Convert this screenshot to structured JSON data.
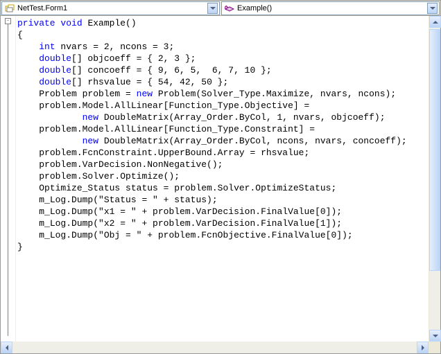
{
  "toolbar": {
    "class_selector": "NetTest.Form1",
    "member_selector": "Example()"
  },
  "code": {
    "lines": [
      {
        "indent": 0,
        "segs": [
          {
            "t": "private",
            "c": "kw"
          },
          {
            "t": " "
          },
          {
            "t": "void",
            "c": "kw"
          },
          {
            "t": " Example()"
          }
        ]
      },
      {
        "indent": 0,
        "segs": [
          {
            "t": "{"
          }
        ]
      },
      {
        "indent": 0,
        "segs": [
          {
            "t": ""
          }
        ]
      },
      {
        "indent": 1,
        "segs": [
          {
            "t": "int",
            "c": "kw"
          },
          {
            "t": " nvars = 2, ncons = 3;"
          }
        ]
      },
      {
        "indent": 1,
        "segs": [
          {
            "t": "double",
            "c": "kw"
          },
          {
            "t": "[] objcoeff = { 2, 3 };"
          }
        ]
      },
      {
        "indent": 1,
        "segs": [
          {
            "t": "double",
            "c": "kw"
          },
          {
            "t": "[] concoeff = { 9, 6, 5,  6, 7, 10 };"
          }
        ]
      },
      {
        "indent": 1,
        "segs": [
          {
            "t": "double",
            "c": "kw"
          },
          {
            "t": "[] rhsvalue = { 54, 42, 50 };"
          }
        ]
      },
      {
        "indent": 0,
        "segs": [
          {
            "t": ""
          }
        ]
      },
      {
        "indent": 1,
        "segs": [
          {
            "t": "Problem problem = "
          },
          {
            "t": "new",
            "c": "kw"
          },
          {
            "t": " Problem(Solver_Type.Maximize, nvars, ncons);"
          }
        ]
      },
      {
        "indent": 0,
        "segs": [
          {
            "t": ""
          }
        ]
      },
      {
        "indent": 1,
        "segs": [
          {
            "t": "problem.Model.AllLinear[Function_Type.Objective] ="
          }
        ]
      },
      {
        "indent": 3,
        "segs": [
          {
            "t": "new",
            "c": "kw"
          },
          {
            "t": " DoubleMatrix(Array_Order.ByCol, 1, nvars, objcoeff);"
          }
        ]
      },
      {
        "indent": 1,
        "segs": [
          {
            "t": "problem.Model.AllLinear[Function_Type.Constraint] ="
          }
        ]
      },
      {
        "indent": 3,
        "segs": [
          {
            "t": "new",
            "c": "kw"
          },
          {
            "t": " DoubleMatrix(Array_Order.ByCol, ncons, nvars, concoeff);"
          }
        ]
      },
      {
        "indent": 0,
        "segs": [
          {
            "t": ""
          }
        ]
      },
      {
        "indent": 1,
        "segs": [
          {
            "t": "problem.FcnConstraint.UpperBound.Array = rhsvalue;"
          }
        ]
      },
      {
        "indent": 0,
        "segs": [
          {
            "t": ""
          }
        ]
      },
      {
        "indent": 1,
        "segs": [
          {
            "t": "problem.VarDecision.NonNegative();"
          }
        ]
      },
      {
        "indent": 0,
        "segs": [
          {
            "t": ""
          }
        ]
      },
      {
        "indent": 1,
        "segs": [
          {
            "t": "problem.Solver.Optimize();"
          }
        ]
      },
      {
        "indent": 1,
        "segs": [
          {
            "t": "Optimize_Status status = problem.Solver.OptimizeStatus;"
          }
        ]
      },
      {
        "indent": 0,
        "segs": [
          {
            "t": ""
          }
        ]
      },
      {
        "indent": 1,
        "segs": [
          {
            "t": "m_Log.Dump(\"Status = \" + status);"
          }
        ]
      },
      {
        "indent": 1,
        "segs": [
          {
            "t": "m_Log.Dump(\"x1 = \" + problem.VarDecision.FinalValue[0]);"
          }
        ]
      },
      {
        "indent": 1,
        "segs": [
          {
            "t": "m_Log.Dump(\"x2 = \" + problem.VarDecision.FinalValue[1]);"
          }
        ]
      },
      {
        "indent": 1,
        "segs": [
          {
            "t": "m_Log.Dump(\"Obj = \" + problem.FcnObjective.FinalValue[0]);"
          }
        ]
      },
      {
        "indent": 0,
        "segs": [
          {
            "t": "}"
          }
        ]
      }
    ]
  }
}
